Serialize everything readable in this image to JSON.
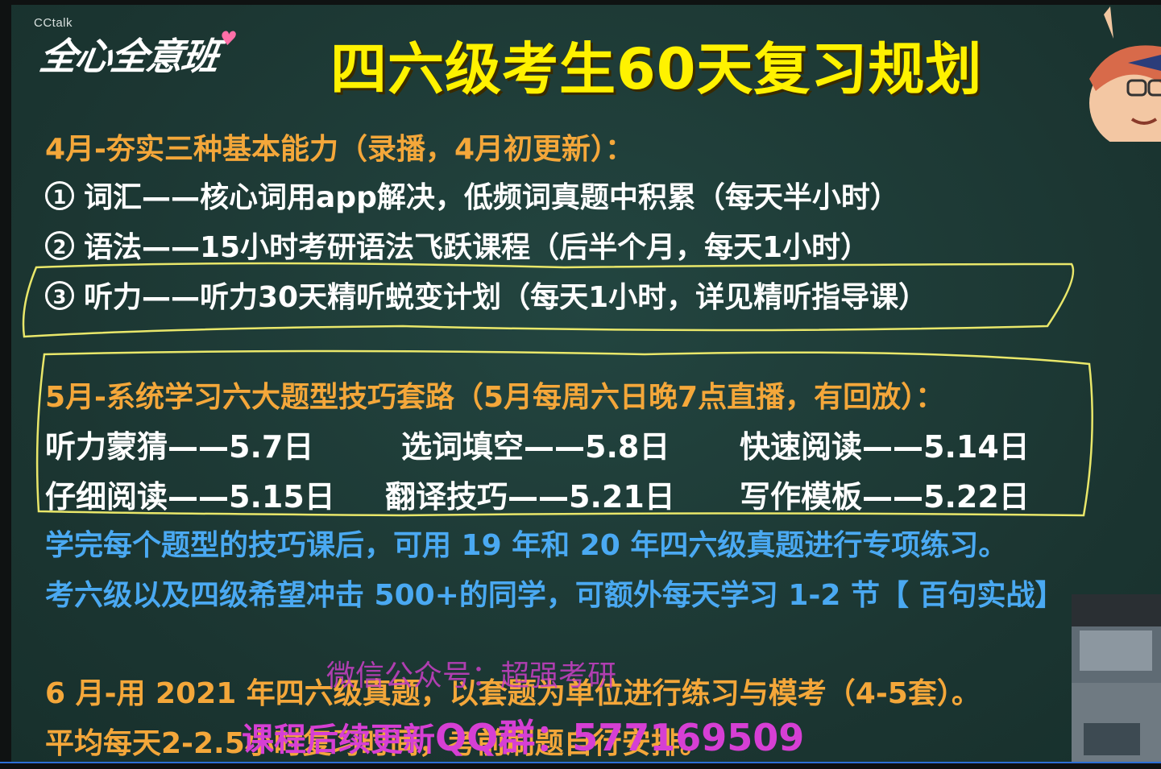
{
  "app_name": "CCtalk",
  "logo_text": "全心全意班",
  "title": "四六级考生60天复习规划",
  "april": {
    "heading": "4月-夯实三种基本能力（录播，4月初更新）：",
    "items": [
      {
        "num": "1",
        "text": "词汇——核心词用app解决，低频词真题中积累（每天半小时）"
      },
      {
        "num": "2",
        "text": "语法——15小时考研语法飞跃课程（后半个月，每天1小时）"
      },
      {
        "num": "3",
        "text": "听力——听力30天精听蜕变计划（每天1小时，详见精听指导课）"
      }
    ]
  },
  "may": {
    "heading": "5月-系统学习六大题型技巧套路（5月每周六日晚7点直播，有回放）：",
    "schedule": [
      "听力蒙猜——5.7日",
      "选词填空——5.8日",
      "快速阅读——5.14日",
      "仔细阅读——5.15日",
      "翻译技巧——5.21日",
      "写作模板——5.22日"
    ],
    "note1": "学完每个题型的技巧课后，可用 19 年和 20 年四六级真题进行专项练习。",
    "note2": "考六级以及四级希望冲击 500+的同学，可额外每天学习 1-2 节【 百句实战】"
  },
  "june": {
    "line1": "6 月-用 2021 年四六级真题，以套题为单位进行练习与模考（4-5套）。",
    "line2": "平均每天2-2.5小时复习时间，考前刷题自行安排。"
  },
  "watermark": {
    "line1": "微信公众号：超强考研",
    "line2_prefix": "课程后续更新",
    "line2_qq": "QQ群：577169509"
  },
  "colors": {
    "board": "#1d3a35",
    "title": "#fff200",
    "heading": "#f4a73a",
    "note": "#4aa9f2",
    "highlight": "#e9e76a",
    "watermark": "#d63fd4"
  }
}
